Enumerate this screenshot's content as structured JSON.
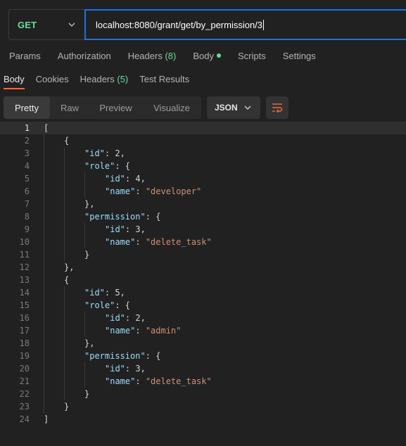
{
  "request": {
    "method": "GET",
    "url": "localhost:8080/grant/get/by_permission/3"
  },
  "request_tabs": [
    {
      "label": "Params"
    },
    {
      "label": "Authorization"
    },
    {
      "label": "Headers",
      "count": "(8)"
    },
    {
      "label": "Body",
      "indicator": "green-dot"
    },
    {
      "label": "Scripts"
    },
    {
      "label": "Settings"
    }
  ],
  "response_tabs": [
    {
      "label": "Body",
      "active": true
    },
    {
      "label": "Cookies"
    },
    {
      "label": "Headers",
      "count": "(5)"
    },
    {
      "label": "Test Results"
    }
  ],
  "view_modes": [
    "Pretty",
    "Raw",
    "Preview",
    "Visualize"
  ],
  "active_view": "Pretty",
  "format": "JSON",
  "icons": {
    "method_caret": "chevron-down-icon",
    "format_caret": "chevron-down-icon",
    "wrap": "wrap-lines-icon"
  },
  "colors": {
    "method": "#6bdd9a",
    "url_border": "#1a73e8",
    "active_tab_underline": "#f26b3a",
    "json_key": "#9cdcfe",
    "json_string": "#ce9178"
  },
  "code_lines": [
    {
      "n": "1",
      "indent": 0,
      "tokens": [
        {
          "t": "p",
          "v": "["
        }
      ]
    },
    {
      "n": "2",
      "indent": 1,
      "tokens": [
        {
          "t": "p",
          "v": "{"
        }
      ]
    },
    {
      "n": "3",
      "indent": 2,
      "tokens": [
        {
          "t": "k",
          "v": "\"id\""
        },
        {
          "t": "p",
          "v": ": "
        },
        {
          "t": "n",
          "v": "2"
        },
        {
          "t": "p",
          "v": ","
        }
      ]
    },
    {
      "n": "4",
      "indent": 2,
      "tokens": [
        {
          "t": "k",
          "v": "\"role\""
        },
        {
          "t": "p",
          "v": ": {"
        }
      ]
    },
    {
      "n": "5",
      "indent": 3,
      "tokens": [
        {
          "t": "k",
          "v": "\"id\""
        },
        {
          "t": "p",
          "v": ": "
        },
        {
          "t": "n",
          "v": "4"
        },
        {
          "t": "p",
          "v": ","
        }
      ]
    },
    {
      "n": "6",
      "indent": 3,
      "tokens": [
        {
          "t": "k",
          "v": "\"name\""
        },
        {
          "t": "p",
          "v": ": "
        },
        {
          "t": "s",
          "v": "\"developer\""
        }
      ]
    },
    {
      "n": "7",
      "indent": 2,
      "tokens": [
        {
          "t": "p",
          "v": "},"
        }
      ]
    },
    {
      "n": "8",
      "indent": 2,
      "tokens": [
        {
          "t": "k",
          "v": "\"permission\""
        },
        {
          "t": "p",
          "v": ": {"
        }
      ]
    },
    {
      "n": "9",
      "indent": 3,
      "tokens": [
        {
          "t": "k",
          "v": "\"id\""
        },
        {
          "t": "p",
          "v": ": "
        },
        {
          "t": "n",
          "v": "3"
        },
        {
          "t": "p",
          "v": ","
        }
      ]
    },
    {
      "n": "10",
      "indent": 3,
      "tokens": [
        {
          "t": "k",
          "v": "\"name\""
        },
        {
          "t": "p",
          "v": ": "
        },
        {
          "t": "s",
          "v": "\"delete_task\""
        }
      ]
    },
    {
      "n": "11",
      "indent": 2,
      "tokens": [
        {
          "t": "p",
          "v": "}"
        }
      ]
    },
    {
      "n": "12",
      "indent": 1,
      "tokens": [
        {
          "t": "p",
          "v": "},"
        }
      ]
    },
    {
      "n": "13",
      "indent": 1,
      "tokens": [
        {
          "t": "p",
          "v": "{"
        }
      ]
    },
    {
      "n": "14",
      "indent": 2,
      "tokens": [
        {
          "t": "k",
          "v": "\"id\""
        },
        {
          "t": "p",
          "v": ": "
        },
        {
          "t": "n",
          "v": "5"
        },
        {
          "t": "p",
          "v": ","
        }
      ]
    },
    {
      "n": "15",
      "indent": 2,
      "tokens": [
        {
          "t": "k",
          "v": "\"role\""
        },
        {
          "t": "p",
          "v": ": {"
        }
      ]
    },
    {
      "n": "16",
      "indent": 3,
      "tokens": [
        {
          "t": "k",
          "v": "\"id\""
        },
        {
          "t": "p",
          "v": ": "
        },
        {
          "t": "n",
          "v": "2"
        },
        {
          "t": "p",
          "v": ","
        }
      ]
    },
    {
      "n": "17",
      "indent": 3,
      "tokens": [
        {
          "t": "k",
          "v": "\"name\""
        },
        {
          "t": "p",
          "v": ": "
        },
        {
          "t": "s",
          "v": "\"admin\""
        }
      ]
    },
    {
      "n": "18",
      "indent": 2,
      "tokens": [
        {
          "t": "p",
          "v": "},"
        }
      ]
    },
    {
      "n": "19",
      "indent": 2,
      "tokens": [
        {
          "t": "k",
          "v": "\"permission\""
        },
        {
          "t": "p",
          "v": ": {"
        }
      ]
    },
    {
      "n": "20",
      "indent": 3,
      "tokens": [
        {
          "t": "k",
          "v": "\"id\""
        },
        {
          "t": "p",
          "v": ": "
        },
        {
          "t": "n",
          "v": "3"
        },
        {
          "t": "p",
          "v": ","
        }
      ]
    },
    {
      "n": "21",
      "indent": 3,
      "tokens": [
        {
          "t": "k",
          "v": "\"name\""
        },
        {
          "t": "p",
          "v": ": "
        },
        {
          "t": "s",
          "v": "\"delete_task\""
        }
      ]
    },
    {
      "n": "22",
      "indent": 2,
      "tokens": [
        {
          "t": "p",
          "v": "}"
        }
      ]
    },
    {
      "n": "23",
      "indent": 1,
      "tokens": [
        {
          "t": "p",
          "v": "}"
        }
      ]
    },
    {
      "n": "24",
      "indent": 0,
      "tokens": [
        {
          "t": "p",
          "v": "]"
        }
      ]
    }
  ]
}
